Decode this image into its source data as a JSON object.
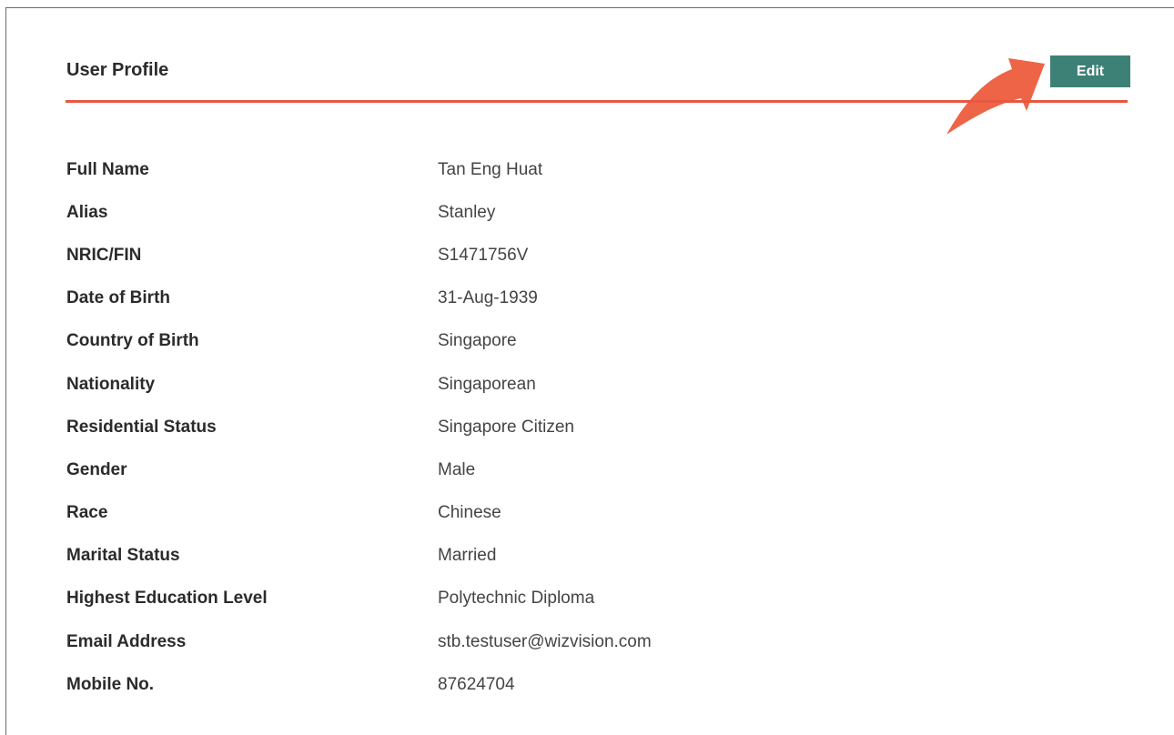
{
  "profile": {
    "title": "User Profile",
    "edit_label": "Edit",
    "accent_color": "#e8573f",
    "button_color": "#3d8176",
    "fields": [
      {
        "label": "Full Name",
        "value": "Tan Eng Huat"
      },
      {
        "label": "Alias",
        "value": "Stanley"
      },
      {
        "label": "NRIC/FIN",
        "value": "S1471756V"
      },
      {
        "label": "Date of Birth",
        "value": "31-Aug-1939"
      },
      {
        "label": "Country of Birth",
        "value": "Singapore"
      },
      {
        "label": "Nationality",
        "value": "Singaporean"
      },
      {
        "label": "Residential Status",
        "value": "Singapore Citizen"
      },
      {
        "label": "Gender",
        "value": "Male"
      },
      {
        "label": "Race",
        "value": "Chinese"
      },
      {
        "label": "Marital Status",
        "value": "Married"
      },
      {
        "label": "Highest Education Level",
        "value": "Polytechnic Diploma"
      },
      {
        "label": "Email Address",
        "value": "stb.testuser@wizvision.com"
      },
      {
        "label": "Mobile No.",
        "value": "87624704"
      }
    ]
  }
}
